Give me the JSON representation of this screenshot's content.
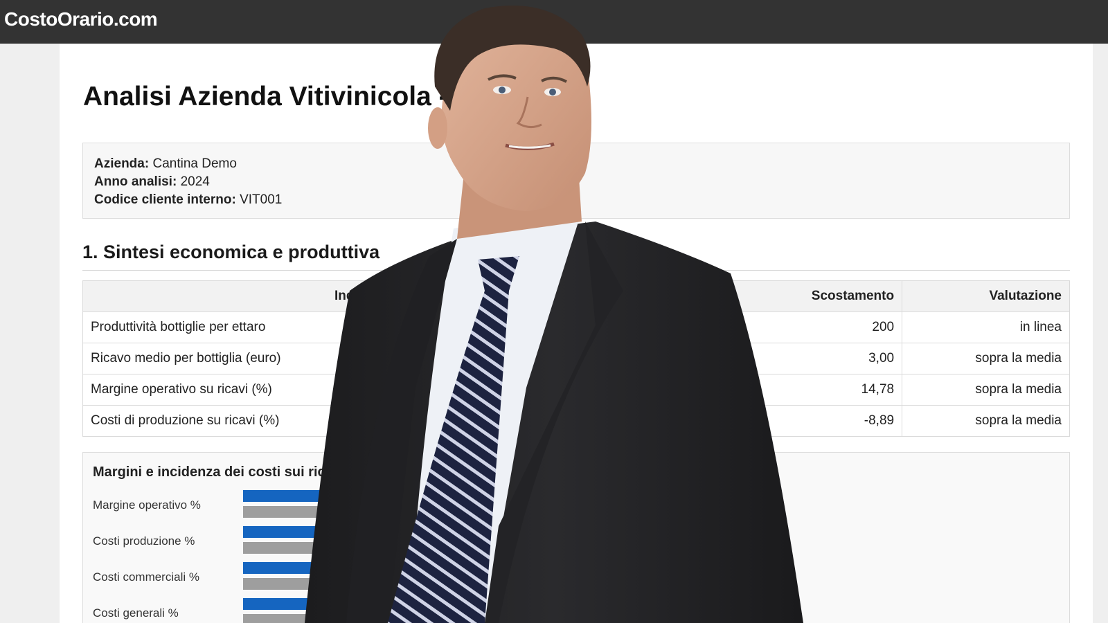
{
  "brand": "CostoOrario.com",
  "title": "Analisi Azienda Vitivinicola -",
  "info": {
    "azienda_label": "Azienda:",
    "azienda_value": " Cantina Demo",
    "anno_label": "Anno analisi:",
    "anno_value": " 2024",
    "codice_label": "Codice cliente interno:",
    "codice_value": " VIT001"
  },
  "section1_title": "1. Sintesi economica e produttiva",
  "table": {
    "headers": [
      "Indic",
      "Scostamento",
      "Valutazione"
    ],
    "rows": [
      {
        "indicatore": "Produttività bottiglie per ettaro",
        "scostamento": "200",
        "valutazione": "in linea"
      },
      {
        "indicatore": "Ricavo medio per bottiglia (euro)",
        "scostamento": "3,00",
        "valutazione": "sopra la media"
      },
      {
        "indicatore": "Margine operativo su ricavi (%)",
        "scostamento": "14,78",
        "valutazione": "sopra la media"
      },
      {
        "indicatore": "Costi di produzione su ricavi (%)",
        "scostamento": "-8,89",
        "valutazione": "sopra la media"
      }
    ]
  },
  "chart_data": {
    "type": "bar",
    "title": "Margini e incidenza dei costi sui rica",
    "categories": [
      "Margine operativo %",
      "Costi produzione %",
      "Costi commerciali %",
      "Costi generali %"
    ],
    "colors": {
      "primary": "#1565c0",
      "secondary": "#9e9e9e"
    }
  },
  "colors": {
    "topbar": "#333333",
    "accent": "#1565c0"
  }
}
